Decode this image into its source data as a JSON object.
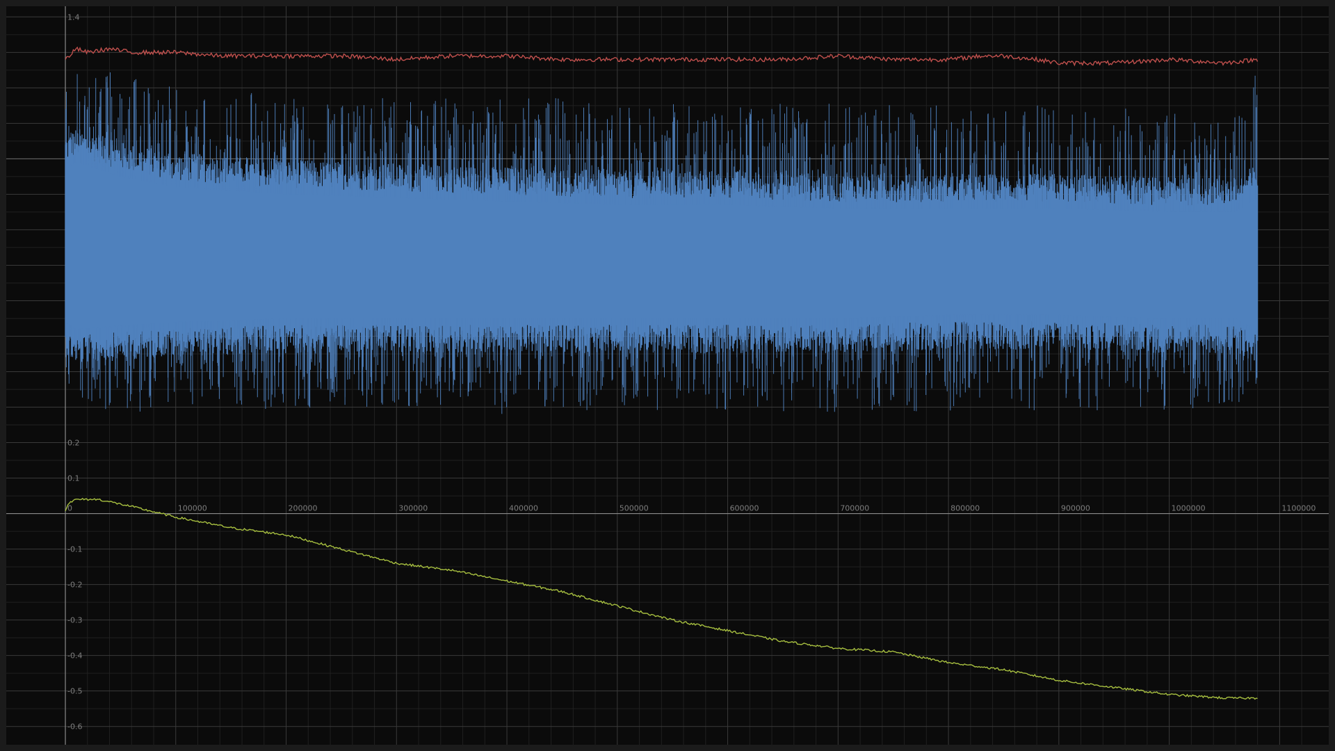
{
  "chart_data": {
    "type": "line",
    "title": "",
    "xlabel": "",
    "ylabel": "",
    "grid": true,
    "legend": "none",
    "x_ticks": [
      "0",
      "100000",
      "200000",
      "300000",
      "400000",
      "500000",
      "600000",
      "700000",
      "800000",
      "900000",
      "1000000",
      "1100000"
    ],
    "y_ticks_top": [
      "1.4",
      "0.2",
      "0.1"
    ],
    "y_ticks_bottom": [
      "-0.1",
      "-0.2",
      "-0.3",
      "-0.4",
      "-0.5",
      "-0.6"
    ],
    "xlim": [
      0,
      1130000
    ],
    "ylim": [
      -0.63,
      1.43
    ],
    "colors": {
      "background": "#0b0b0b",
      "frame": "#1b1b1b",
      "grid_major": "#3a3a3a",
      "grid_minor": "#202020",
      "axis": "#8a8a8a"
    },
    "series": [
      {
        "color": "#c0504d",
        "description": "slowly varying upper trace",
        "x": [
          0,
          10000,
          20000,
          40000,
          60000,
          100000,
          140000,
          180000,
          250000,
          300000,
          350000,
          400000,
          450000,
          500000,
          550000,
          600000,
          650000,
          700000,
          750000,
          800000,
          830000,
          850000,
          880000,
          900000,
          950000,
          1000000,
          1050000,
          1080000
        ],
        "y": [
          1.28,
          1.31,
          1.3,
          1.31,
          1.3,
          1.3,
          1.29,
          1.29,
          1.29,
          1.28,
          1.29,
          1.29,
          1.28,
          1.28,
          1.28,
          1.28,
          1.28,
          1.29,
          1.28,
          1.28,
          1.29,
          1.29,
          1.28,
          1.27,
          1.27,
          1.28,
          1.27,
          1.28
        ]
      },
      {
        "color": "#4f81bd",
        "description": "dense noisy trace, envelope per x",
        "x": [
          0,
          10000,
          50000,
          100000,
          200000,
          300000,
          400000,
          500000,
          600000,
          700000,
          800000,
          900000,
          1000000,
          1060000,
          1080000
        ],
        "upper": [
          1.27,
          1.28,
          1.24,
          1.2,
          1.18,
          1.17,
          1.18,
          1.16,
          1.15,
          1.16,
          1.16,
          1.16,
          1.13,
          1.13,
          1.25
        ],
        "lower": [
          0.3,
          0.32,
          0.28,
          0.3,
          0.29,
          0.3,
          0.28,
          0.29,
          0.29,
          0.28,
          0.29,
          0.29,
          0.29,
          0.3,
          0.33
        ],
        "dense_upper": [
          1.02,
          1.04,
          1.0,
          0.97,
          0.95,
          0.94,
          0.93,
          0.92,
          0.92,
          0.91,
          0.91,
          0.91,
          0.9,
          0.9,
          0.94
        ],
        "dense_lower": [
          0.49,
          0.47,
          0.48,
          0.49,
          0.5,
          0.5,
          0.5,
          0.5,
          0.5,
          0.5,
          0.51,
          0.51,
          0.5,
          0.5,
          0.47
        ]
      },
      {
        "color": "#a8c040",
        "description": "slowly decreasing trace",
        "x": [
          0,
          3000,
          10000,
          30000,
          60000,
          100000,
          150000,
          200000,
          250000,
          300000,
          350000,
          400000,
          450000,
          500000,
          550000,
          600000,
          650000,
          700000,
          750000,
          800000,
          850000,
          900000,
          950000,
          1000000,
          1050000,
          1080000
        ],
        "y": [
          0.01,
          0.03,
          0.04,
          0.04,
          0.02,
          -0.01,
          -0.04,
          -0.06,
          -0.1,
          -0.14,
          -0.16,
          -0.19,
          -0.22,
          -0.26,
          -0.3,
          -0.33,
          -0.36,
          -0.38,
          -0.39,
          -0.42,
          -0.44,
          -0.47,
          -0.49,
          -0.51,
          -0.52,
          -0.52
        ]
      }
    ]
  }
}
